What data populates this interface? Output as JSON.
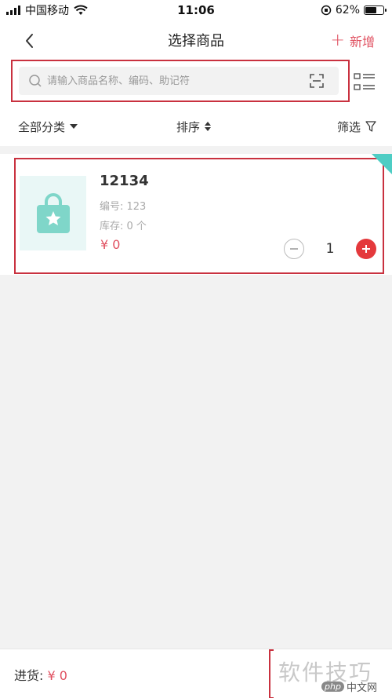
{
  "status_bar": {
    "carrier": "中国移动",
    "time": "11:06",
    "battery_percent": "62%",
    "battery_level": 0.62
  },
  "header": {
    "back_icon": "chevron-left-icon",
    "title": "选择商品",
    "add_label": "新增"
  },
  "search": {
    "placeholder": "请输入商品名称、编码、助记符",
    "value": "",
    "scan_icon": "scan-icon",
    "view_icon": "list-view-icon"
  },
  "filters": {
    "category_label": "全部分类",
    "sort_label": "排序",
    "filter_label": "筛选"
  },
  "product": {
    "name": "12134",
    "code": "编号: 123",
    "stock": "库存: 0 个",
    "price": "¥ 0",
    "quantity": "1",
    "image_icon": "shopping-bag-star-icon",
    "badge_color": "#4ecdc4"
  },
  "footer": {
    "purchase_label": "进货:",
    "purchase_amount": "¥ 0"
  },
  "watermark": {
    "text": "软件技巧",
    "site_logo": "php",
    "site_name": "中文网"
  },
  "colors": {
    "accent": "#e05060",
    "highlight_border": "#c9313f",
    "plus_button": "#e4393c",
    "product_icon": "#7fd6c9"
  }
}
